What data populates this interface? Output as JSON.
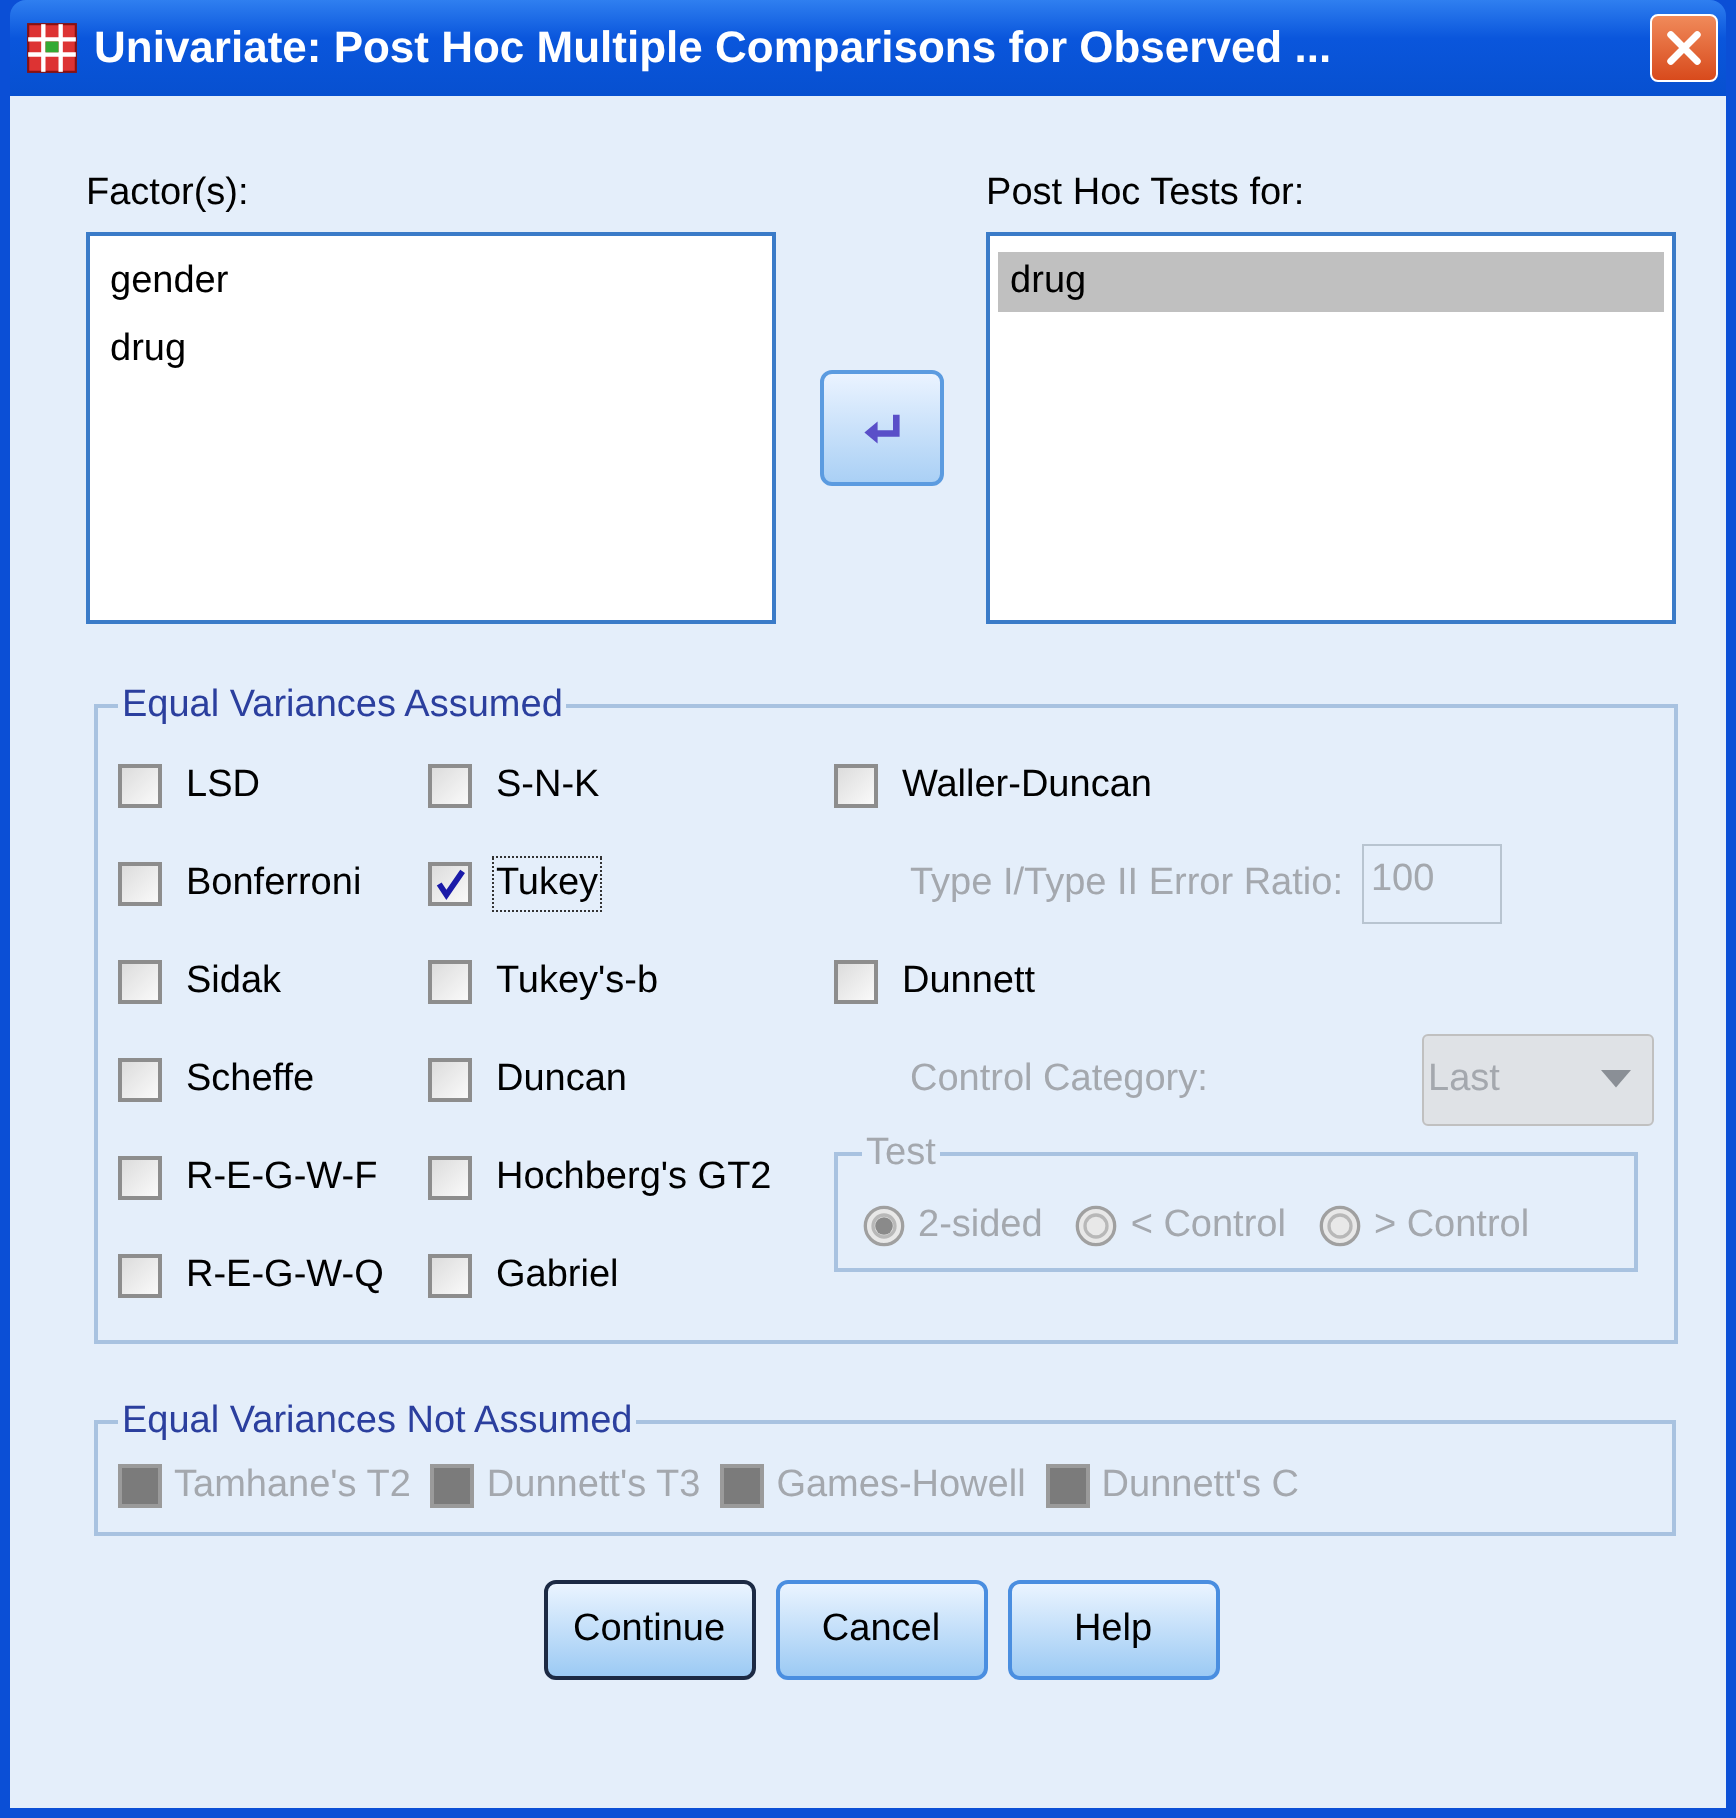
{
  "window": {
    "title": "Univariate: Post Hoc Multiple Comparisons for Observed ..."
  },
  "factors": {
    "label": "Factor(s):",
    "items": [
      {
        "text": "gender",
        "selected": false
      },
      {
        "text": "drug",
        "selected": false
      }
    ]
  },
  "post_hoc_tests_for": {
    "label": "Post Hoc Tests for:",
    "items": [
      {
        "text": "drug",
        "selected": true
      }
    ]
  },
  "equal_variances_assumed": {
    "title": "Equal Variances Assumed",
    "columns": [
      [
        {
          "label": "LSD",
          "checked": false,
          "focused": false
        },
        {
          "label": "Bonferroni",
          "checked": false,
          "focused": false
        },
        {
          "label": "Sidak",
          "checked": false,
          "focused": false
        },
        {
          "label": "Scheffe",
          "checked": false,
          "focused": false
        },
        {
          "label": "R-E-G-W-F",
          "checked": false,
          "focused": false
        },
        {
          "label": "R-E-G-W-Q",
          "checked": false,
          "focused": false
        }
      ],
      [
        {
          "label": "S-N-K",
          "checked": false,
          "focused": false
        },
        {
          "label": "Tukey",
          "checked": true,
          "focused": true
        },
        {
          "label": "Tukey's-b",
          "checked": false,
          "focused": false
        },
        {
          "label": "Duncan",
          "checked": false,
          "focused": false
        },
        {
          "label": "Hochberg's GT2",
          "checked": false,
          "focused": false
        },
        {
          "label": "Gabriel",
          "checked": false,
          "focused": false
        }
      ],
      [
        {
          "kind": "checkbox",
          "label": "Waller-Duncan",
          "checked": false,
          "disabled": false
        },
        {
          "kind": "number_field",
          "label": "Type I/Type II Error Ratio:",
          "value": "100",
          "disabled": true
        },
        {
          "kind": "checkbox",
          "label": "Dunnett",
          "checked": false,
          "disabled": false
        },
        {
          "kind": "dropdown",
          "label": "Control Category:",
          "value": "Last",
          "disabled": true
        }
      ]
    ],
    "test": {
      "title": "Test",
      "disabled": true,
      "options": [
        {
          "label": "2-sided",
          "selected": true
        },
        {
          "label": "< Control",
          "selected": false
        },
        {
          "label": "> Control",
          "selected": false
        }
      ]
    }
  },
  "equal_variances_not_assumed": {
    "title": "Equal Variances Not Assumed",
    "items": [
      {
        "label": "Tamhane's T2",
        "checked": false,
        "disabled": true
      },
      {
        "label": "Dunnett's T3",
        "checked": false,
        "disabled": true
      },
      {
        "label": "Games-Howell",
        "checked": false,
        "disabled": true
      },
      {
        "label": "Dunnett's C",
        "checked": false,
        "disabled": true
      }
    ]
  },
  "buttons": [
    {
      "label": "Continue",
      "default": true
    },
    {
      "label": "Cancel",
      "default": false
    },
    {
      "label": "Help",
      "default": false
    }
  ]
}
